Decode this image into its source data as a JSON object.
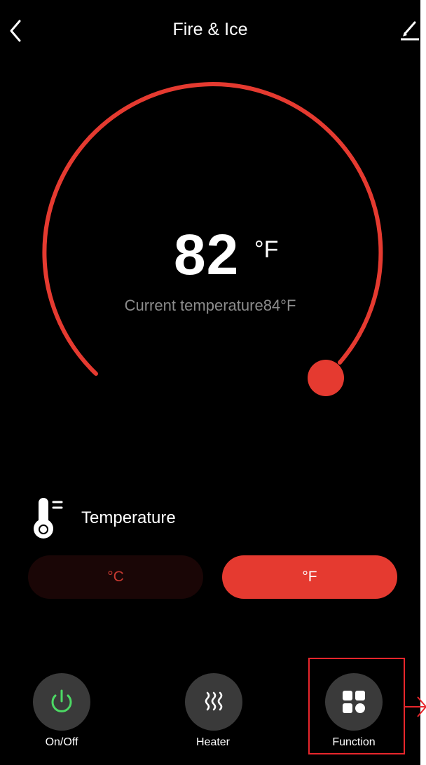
{
  "header": {
    "title": "Fire & Ice"
  },
  "dial": {
    "set_temperature": "82",
    "set_unit": "°F",
    "current_label": "Current temperature",
    "current_value": "84°F",
    "accent_color": "#e53a30"
  },
  "temperature_section": {
    "label": "Temperature",
    "icon": "thermometer-icon",
    "units": [
      {
        "label": "°C",
        "selected": false
      },
      {
        "label": "°F",
        "selected": true
      }
    ]
  },
  "bottom_actions": [
    {
      "label": "On/Off",
      "icon": "power-icon",
      "icon_color": "#4cd964"
    },
    {
      "label": "Heater",
      "icon": "heat-waves-icon",
      "icon_color": "#ffffff"
    },
    {
      "label": "Function",
      "icon": "grid-shapes-icon",
      "icon_color": "#ffffff",
      "highlighted": true
    }
  ],
  "annotation": {
    "highlight_color": "#e8262c"
  }
}
